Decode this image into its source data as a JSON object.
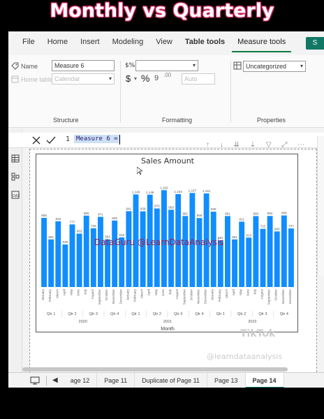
{
  "caption": "Monthly vs Quarterly",
  "ribbon_tabs": [
    {
      "label": "File"
    },
    {
      "label": "Home"
    },
    {
      "label": "Insert"
    },
    {
      "label": "Modeling"
    },
    {
      "label": "View"
    },
    {
      "label": "Table tools"
    },
    {
      "label": "Measure tools"
    }
  ],
  "share_label": "S",
  "structure": {
    "name_label": "Name",
    "name_value": "Measure 6",
    "home_table_label": "Home table",
    "home_table_value": "Calendar",
    "group_label": "Structure"
  },
  "formatting": {
    "format_value": "",
    "currency_symbol": "$",
    "percent_symbol": "%",
    "comma_symbol": "9",
    "decimals_symbol": ".00",
    "auto_value": "Auto",
    "group_label": "Formatting"
  },
  "properties": {
    "category_value": "Uncategorized",
    "group_label": "Properties"
  },
  "formula": {
    "line_number": "1",
    "code": "Measure 6 ="
  },
  "chart_data": {
    "type": "bar",
    "title": "Sales Amount",
    "xlabel": "Month",
    "color": "#118dff",
    "months": [
      "January",
      "February",
      "March",
      "April",
      "May",
      "June",
      "July",
      "August",
      "September",
      "October",
      "November",
      "December"
    ],
    "values": [
      858,
      591,
      816,
      528,
      777,
      663,
      886,
      729,
      871,
      592,
      825,
      616,
      941,
      1149,
      939,
      1146,
      975,
      1202,
      959,
      1153,
      881,
      1167,
      856,
      1161,
      935,
      581,
      881,
      591,
      811,
      613,
      880,
      722,
      882,
      690,
      888,
      727
    ],
    "labels": [
      "858",
      "591",
      "816",
      "528",
      "777",
      "663",
      "886",
      "729",
      "871",
      "592",
      "825",
      "616",
      "941",
      "1,149",
      "939",
      "1,146",
      "975",
      "1,202",
      "959",
      "1,153",
      "881",
      "1,167",
      "856",
      "1,161",
      "935",
      "581",
      "881",
      "591",
      "811",
      "613",
      "880",
      "722",
      "882",
      "690",
      "888",
      "727"
    ],
    "quarters": [
      "Qtr 1",
      "Qtr 2",
      "Qtr 3",
      "Qtr 4"
    ],
    "years": [
      "2020",
      "2021",
      "2022"
    ],
    "ylim": [
      0,
      1300
    ]
  },
  "watermark_text": "DataGuru @LearnDataAnalysis",
  "tiktok_text": "TikTok",
  "tiktok_handle": "@learndataanalysis",
  "pages": [
    {
      "label": "age 12"
    },
    {
      "label": "Page 11"
    },
    {
      "label": "Duplicate of Page 11"
    },
    {
      "label": "Page 13"
    },
    {
      "label": "Page 14",
      "active": true
    }
  ]
}
